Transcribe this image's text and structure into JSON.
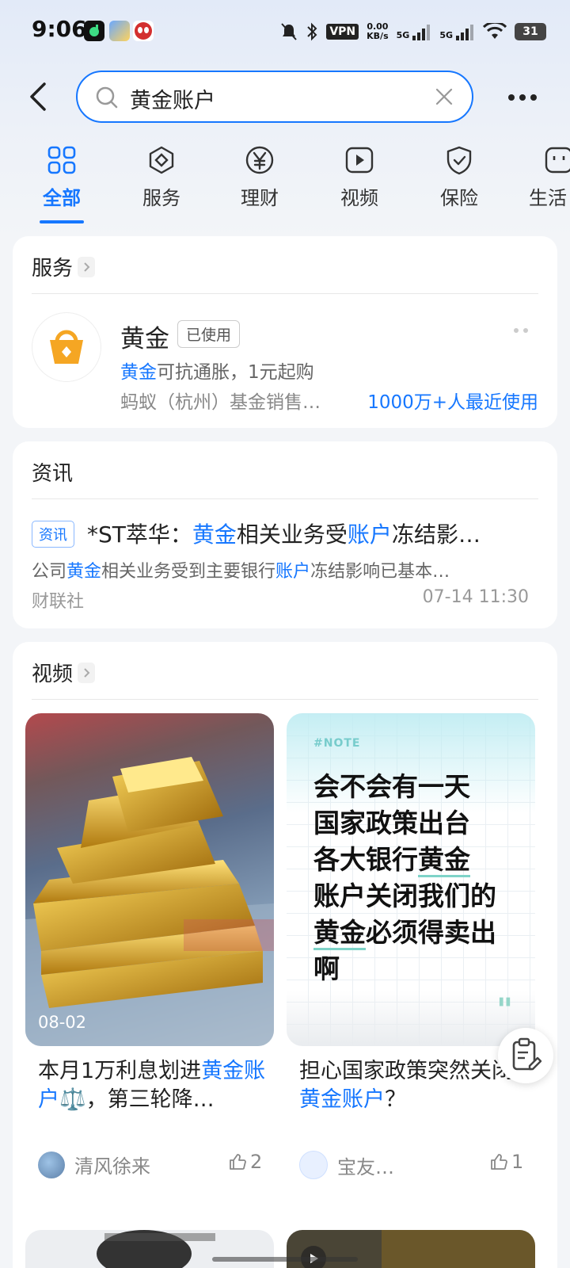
{
  "status_bar": {
    "time": "9:06",
    "vpn": "VPN",
    "speed_value": "0.00",
    "speed_unit": "KB/s",
    "net1": "5G",
    "net2": "5G",
    "battery": "31"
  },
  "search": {
    "query": "黄金账户"
  },
  "tabs": [
    {
      "label": "全部",
      "icon": "grid-icon",
      "active": true
    },
    {
      "label": "服务",
      "icon": "service-cube-icon"
    },
    {
      "label": "理财",
      "icon": "yuan-icon"
    },
    {
      "label": "视频",
      "icon": "video-play-icon"
    },
    {
      "label": "保险",
      "icon": "shield-check-icon"
    },
    {
      "label": "生活",
      "icon": "life-icon"
    }
  ],
  "service_section": {
    "title": "服务",
    "item": {
      "name": "黄金",
      "badge": "已使用",
      "desc_highlight": "黄金",
      "desc_rest": "可抗通胀，1元起购",
      "company": "蚂蚁（杭州）基金销售…",
      "usage": "1000万+人最近使用"
    }
  },
  "news_section": {
    "title": "资讯",
    "item": {
      "tag": "资讯",
      "title_parts": [
        "*ST萃华：",
        "黄金",
        "相关业务受",
        "账户",
        "冻结影…"
      ],
      "summary_parts": [
        "公司",
        "黄金",
        "相关业务受到主要银行",
        "账户",
        "冻结影响已基本…"
      ],
      "source": "财联社",
      "time": "07-14 11:30"
    }
  },
  "video_section": {
    "title": "视频",
    "videos": [
      {
        "date": "08-02",
        "title_parts": [
          "本月1万利息划进",
          "黄金账户",
          "⚖️，第三轮降…"
        ],
        "author": "清风徐来",
        "likes": "2"
      },
      {
        "note_tag": "#NOTE",
        "note_lines": [
          "会不会有一天",
          "国家政策出台",
          "各大银行",
          "黄金",
          "账户关闭我们的",
          "黄金",
          "必须得卖出",
          "啊"
        ],
        "note_quote": "\"",
        "title_parts": [
          "担心国家政策突然关闭",
          "黄金账户",
          "？"
        ],
        "author": "宝友…",
        "likes": "1"
      }
    ]
  },
  "colors": {
    "accent": "#1677ff",
    "gold": "#f5a623"
  }
}
